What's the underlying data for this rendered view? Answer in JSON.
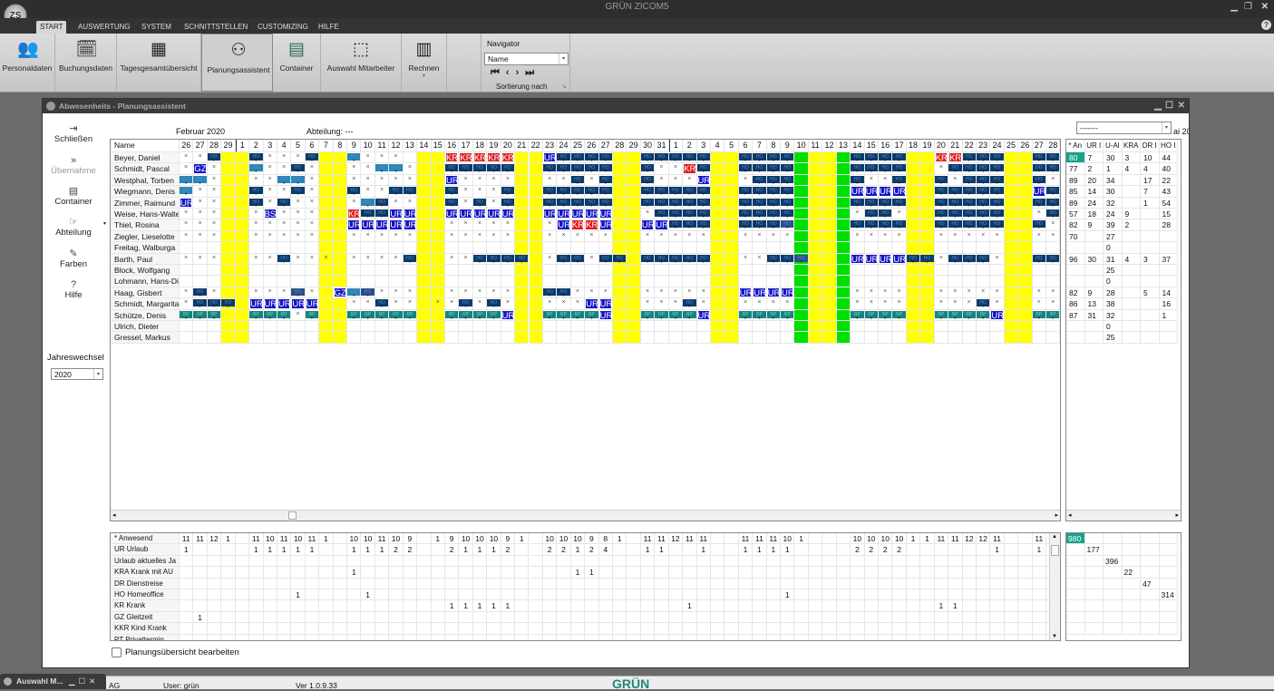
{
  "app": {
    "title": "GRÜN ZICOM5",
    "logo": "ZS"
  },
  "tabs": [
    {
      "label": "START"
    },
    {
      "label": "AUSWERTUNG"
    },
    {
      "label": "SYSTEM"
    },
    {
      "label": "SCHNITTSTELLEN"
    },
    {
      "label": "CUSTOMIZING"
    },
    {
      "label": "HILFE"
    }
  ],
  "ribbon": {
    "buttons": [
      {
        "label": "Personaldaten",
        "icon": "people-icon"
      },
      {
        "label": "Buchungsdaten",
        "icon": "calendar-clock-icon"
      },
      {
        "label": "Tagesgesamtübersicht",
        "icon": "table-icon"
      },
      {
        "label": "Planungsassistent",
        "icon": "group-icon"
      },
      {
        "label": "Container",
        "icon": "cabinet-icon"
      },
      {
        "label": "Auswahl Mitarbeiter",
        "icon": "select-search-icon"
      },
      {
        "label": "Rechnen",
        "icon": "calculator-icon"
      }
    ],
    "navigator": {
      "title": "Navigator",
      "value": "Name",
      "footer": "Sortierung nach"
    }
  },
  "window": {
    "title": "Abwesenheits - Planungsassistent",
    "month": "Februar 2020",
    "department_label": "Abteilung:",
    "department_value": "---",
    "right_select": "-------",
    "right_cut": "ai 20"
  },
  "sidebar": [
    {
      "label": "Schließen",
      "icon": "exit-icon"
    },
    {
      "label": "Übernahme",
      "icon": "forward-icon",
      "disabled": true
    },
    {
      "label": "Container",
      "icon": "cabinet-icon"
    },
    {
      "label": "Abteilung",
      "icon": "hand-pointer-icon"
    },
    {
      "label": "Farben",
      "icon": "brush-icon"
    },
    {
      "label": "Hilfe",
      "icon": "help-icon"
    }
  ],
  "year_change": {
    "label": "Jahreswechsel",
    "value": "2020"
  },
  "grid": {
    "name_header": "Name",
    "days": [
      "26",
      "27",
      "28",
      "29",
      "1",
      "2",
      "3",
      "4",
      "5",
      "6",
      "7",
      "8",
      "9",
      "10",
      "11",
      "12",
      "13",
      "14",
      "15",
      "16",
      "17",
      "18",
      "19",
      "20",
      "21",
      "22",
      "23",
      "24",
      "25",
      "26",
      "27",
      "28",
      "29",
      "30",
      "31",
      "1",
      "2",
      "3",
      "4",
      "5",
      "6",
      "7",
      "8",
      "9",
      "10",
      "11",
      "12",
      "13",
      "14",
      "15",
      "16",
      "17",
      "18",
      "19",
      "20",
      "21",
      "22",
      "23",
      "24",
      "25",
      "26",
      "27",
      "28"
    ],
    "weekend_days": [
      3,
      4,
      10,
      11,
      17,
      18,
      24,
      25,
      31,
      32,
      38,
      39,
      45,
      46,
      52,
      53,
      59,
      60
    ],
    "holiday_days": [
      44,
      47
    ],
    "codes": {
      "H": "HO",
      "h": "HO",
      "U": "UR",
      "K": "KR",
      "A": "KRA",
      "D": "DR",
      "R": "RP",
      "G": "GZ",
      "B": "BSS"
    },
    "colors": {
      "H": "#0b3a6b",
      "h": "#2a4f8a",
      "U": "#1414c8",
      "K": "#e01c1c",
      "A": "#e01c1c",
      "D": "#2b86b8",
      "R": "#16837f",
      "G": "#1414c8",
      "B": "#1414c8",
      "weekend": "#ffff00",
      "holiday": "#00e000",
      "highlight": "#14a38b"
    },
    "employees": [
      {
        "name": "Beyer, Daniel",
        "cells": "xxH..HxxxH..Dxxx...KKKKK..UHHHH..HHHHH..HHHH....HHHH..KKHHH..HH"
      },
      {
        "name": "Schmidt, Pascal",
        "cells": "xGx..DxxHx..xxDDx..HHHHH..HHHHH..HxxKH..HHHH....HHHH..xHHHH..HH"
      },
      {
        "name": "Westphal, Torben",
        "cells": "DDx..xxDDx..xxxxx..Uxxxx..xxHxH..HxxxU..xHHH....HxxH..HxHHH..Hx"
      },
      {
        "name": "Wiegmann, Denis",
        "cells": "Dxx..HxxHx..HxxHH..HxxxH..HHHHH..HHHHH..HHHH....UUUU..HHHHH..UH"
      },
      {
        "name": "Zimmer, Raimund",
        "cells": "Uxx..HxHxx..xDHxx..HxHxH..HHHHH..HHHHH..HHHH....HHHH..HHHHH..HH"
      },
      {
        "name": "Weise, Hans-Walter",
        "cells": "xxx..xBxxx..AHHUU..UUUUU..UUUUU..xHHHH..HHHH....xHHx..HHHHH..xH"
      },
      {
        "name": "Thiel, Rosina",
        "cells": "xxx..xxxxx..UUUUU..xxxxx..xUAAU..UUHHH..HHHh....HHHH..HHHHH..Hx"
      },
      {
        "name": "Ziegler, Lieselotte",
        "cells": "xxx..xxxxx..xxxxx..xxxxx..xxxxx..xxxxx..xxxx....xxxx..xxxxx..xx"
      },
      {
        "name": "Freitag, Walburga",
        "cells": ""
      },
      {
        "name": "Barth, Paul",
        "cells": "xxx..xxHxxx.xxxxH..xxHHHH.xHHxHH.HHHHH..xxHHh...UUUUHHxHHHx..HH"
      },
      {
        "name": "Block, Wolfgang",
        "cells": ""
      },
      {
        "name": "Lohmann, Hans-Dieter",
        "cells": ""
      },
      {
        "name": "Haag, Gisbert",
        "cells": "xHx..xxxhx.GDhxxx..xxxxx..HHxxx..xxxxx..UUUU....xxxx..xxxxx..xx"
      },
      {
        "name": "Schmidt, Margarita",
        "cells": "xHHH.UUUUU..xxHxx.xxHxHx..xxxUU..xxxHx..xxxx....xxxx..xxxHx..xx"
      },
      {
        "name": "Schütze, Denis",
        "cells": "RRR..RRRxR..RRRRR..RRRRU..RRRRU..RRRRU..RRRR....RRRR..RRRRU..RR"
      },
      {
        "name": "Ulrich, Dieter",
        "cells": ""
      },
      {
        "name": "Gressel, Markus",
        "cells": ""
      }
    ]
  },
  "right_panel": {
    "headers": [
      "* An",
      "UR I",
      "U-Al",
      "KRA",
      "DR I",
      "HO I"
    ],
    "rows": [
      [
        "80",
        "7",
        "30",
        "3",
        "10",
        "44"
      ],
      [
        "77",
        "2",
        "1",
        "4",
        "4",
        "40"
      ],
      [
        "89",
        "20",
        "34",
        "",
        "17",
        "22"
      ],
      [
        "85",
        "14",
        "30",
        "",
        "7",
        "43"
      ],
      [
        "89",
        "24",
        "32",
        "",
        "1",
        "54"
      ],
      [
        "57",
        "18",
        "24",
        "9",
        "",
        "15"
      ],
      [
        "82",
        "9",
        "39",
        "2",
        "",
        "28"
      ],
      [
        "70",
        "",
        "27",
        "",
        "",
        ""
      ],
      [
        "",
        "",
        "0",
        "",
        "",
        ""
      ],
      [
        "96",
        "30",
        "31",
        "4",
        "3",
        "37"
      ],
      [
        "",
        "",
        "25",
        "",
        "",
        ""
      ],
      [
        "",
        "",
        "0",
        "",
        "",
        ""
      ],
      [
        "82",
        "9",
        "28",
        "",
        "5",
        "14"
      ],
      [
        "86",
        "13",
        "38",
        "",
        "",
        "16"
      ],
      [
        "87",
        "31",
        "32",
        "",
        "",
        "1"
      ],
      [
        "",
        "",
        "0",
        "",
        "",
        ""
      ],
      [
        "",
        "",
        "25",
        "",
        "",
        ""
      ]
    ]
  },
  "summary": {
    "rows": [
      {
        "label": "* Anwesend",
        "values": {
          "0": "11",
          "1": "11",
          "2": "12",
          "3": "1",
          "5": "11",
          "6": "10",
          "7": "11",
          "8": "10",
          "9": "11",
          "10": "1",
          "12": "10",
          "13": "10",
          "14": "11",
          "15": "10",
          "16": "9",
          "18": "1",
          "19": "9",
          "20": "10",
          "21": "10",
          "22": "10",
          "23": "9",
          "24": "1",
          "26": "10",
          "27": "10",
          "28": "10",
          "29": "9",
          "30": "8",
          "31": "1",
          "33": "11",
          "34": "11",
          "35": "12",
          "36": "11",
          "37": "11",
          "40": "11",
          "41": "11",
          "42": "11",
          "43": "10",
          "44": "1",
          "48": "10",
          "49": "10",
          "50": "10",
          "51": "10",
          "52": "1",
          "53": "1",
          "54": "11",
          "55": "11",
          "56": "12",
          "57": "12",
          "58": "11",
          "61": "11",
          "62": "1"
        }
      },
      {
        "label": "UR Urlaub",
        "values": {
          "0": "1",
          "5": "1",
          "6": "1",
          "7": "1",
          "8": "1",
          "9": "1",
          "12": "1",
          "13": "1",
          "14": "1",
          "15": "2",
          "16": "2",
          "19": "2",
          "20": "1",
          "21": "1",
          "22": "1",
          "23": "2",
          "26": "2",
          "27": "2",
          "28": "1",
          "29": "2",
          "30": "4",
          "33": "1",
          "34": "1",
          "37": "1",
          "40": "1",
          "41": "1",
          "42": "1",
          "43": "1",
          "48": "2",
          "49": "2",
          "50": "2",
          "51": "2",
          "58": "1",
          "61": "1"
        }
      },
      {
        "label": " Urlaub aktuelles Ja",
        "values": {}
      },
      {
        "label": "KRA Krank mit AU",
        "values": {
          "12": "1",
          "28": "1",
          "29": "1"
        }
      },
      {
        "label": "DR Dienstreise",
        "values": {}
      },
      {
        "label": "HO Homeoffice",
        "values": {
          "8": "1",
          "13": "1",
          "43": "1"
        }
      },
      {
        "label": "KR Krank",
        "values": {
          "19": "1",
          "20": "1",
          "21": "1",
          "22": "1",
          "23": "1",
          "36": "1",
          "54": "1",
          "55": "1"
        }
      },
      {
        "label": "GZ Gleitzeit",
        "values": {
          "1": "1"
        }
      },
      {
        "label": "KKR Kind Krank",
        "values": {}
      },
      {
        "label": "PT Privattermin",
        "values": {}
      }
    ],
    "totals": [
      "980",
      "177",
      "396",
      "22",
      "47",
      "314"
    ]
  },
  "edit_checkbox": {
    "label": "Planungsübersicht bearbeiten",
    "checked": false
  },
  "statusbar": {
    "company": "AG",
    "user": "User: grün",
    "version": "Ver 1.0.9.33",
    "brand": "GRÜN"
  },
  "minimized": {
    "title": "Auswahl M..."
  }
}
